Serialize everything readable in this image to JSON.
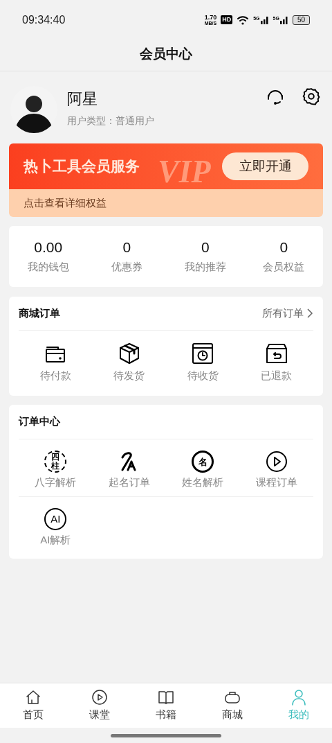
{
  "status_bar": {
    "time": "09:34:40",
    "speed": "1.70",
    "speed_unit": "MB/S",
    "hd": "HD",
    "network_1": "5G",
    "network_2": "5G",
    "battery": "50"
  },
  "header": {
    "title": "会员中心"
  },
  "profile": {
    "name": "阿星",
    "user_type": "用户类型：普通用户"
  },
  "vip_banner": {
    "title": "热卜工具会员服务",
    "watermark": "VIP",
    "button": "立即开通",
    "details": "点击查看详细权益"
  },
  "stats": [
    {
      "value": "0.00",
      "label": "我的钱包"
    },
    {
      "value": "0",
      "label": "优惠券"
    },
    {
      "value": "0",
      "label": "我的推荐"
    },
    {
      "value": "0",
      "label": "会员权益"
    }
  ],
  "mall_orders": {
    "title": "商城订单",
    "link": "所有订单",
    "items": [
      {
        "kind": "wallet",
        "label": "待付款"
      },
      {
        "kind": "box",
        "label": "待发货"
      },
      {
        "kind": "clock",
        "label": "待收货"
      },
      {
        "kind": "return",
        "label": "已退款"
      }
    ]
  },
  "order_center": {
    "title": "订单中心",
    "items": [
      {
        "kind": "bazi",
        "label": "八字解析",
        "icon_text": "四柱"
      },
      {
        "kind": "naming",
        "label": "起名订单"
      },
      {
        "kind": "name",
        "label": "姓名解析",
        "icon_text": "名"
      },
      {
        "kind": "course",
        "label": "课程订单"
      },
      {
        "kind": "ai",
        "label": "AI解析",
        "icon_text": "AI"
      }
    ]
  },
  "bottom_nav": [
    {
      "kind": "home",
      "label": "首页",
      "selected": false
    },
    {
      "kind": "play",
      "label": "课堂",
      "selected": false
    },
    {
      "kind": "book",
      "label": "书籍",
      "selected": false
    },
    {
      "kind": "shop",
      "label": "商城",
      "selected": false
    },
    {
      "kind": "user",
      "label": "我的",
      "selected": true
    }
  ]
}
